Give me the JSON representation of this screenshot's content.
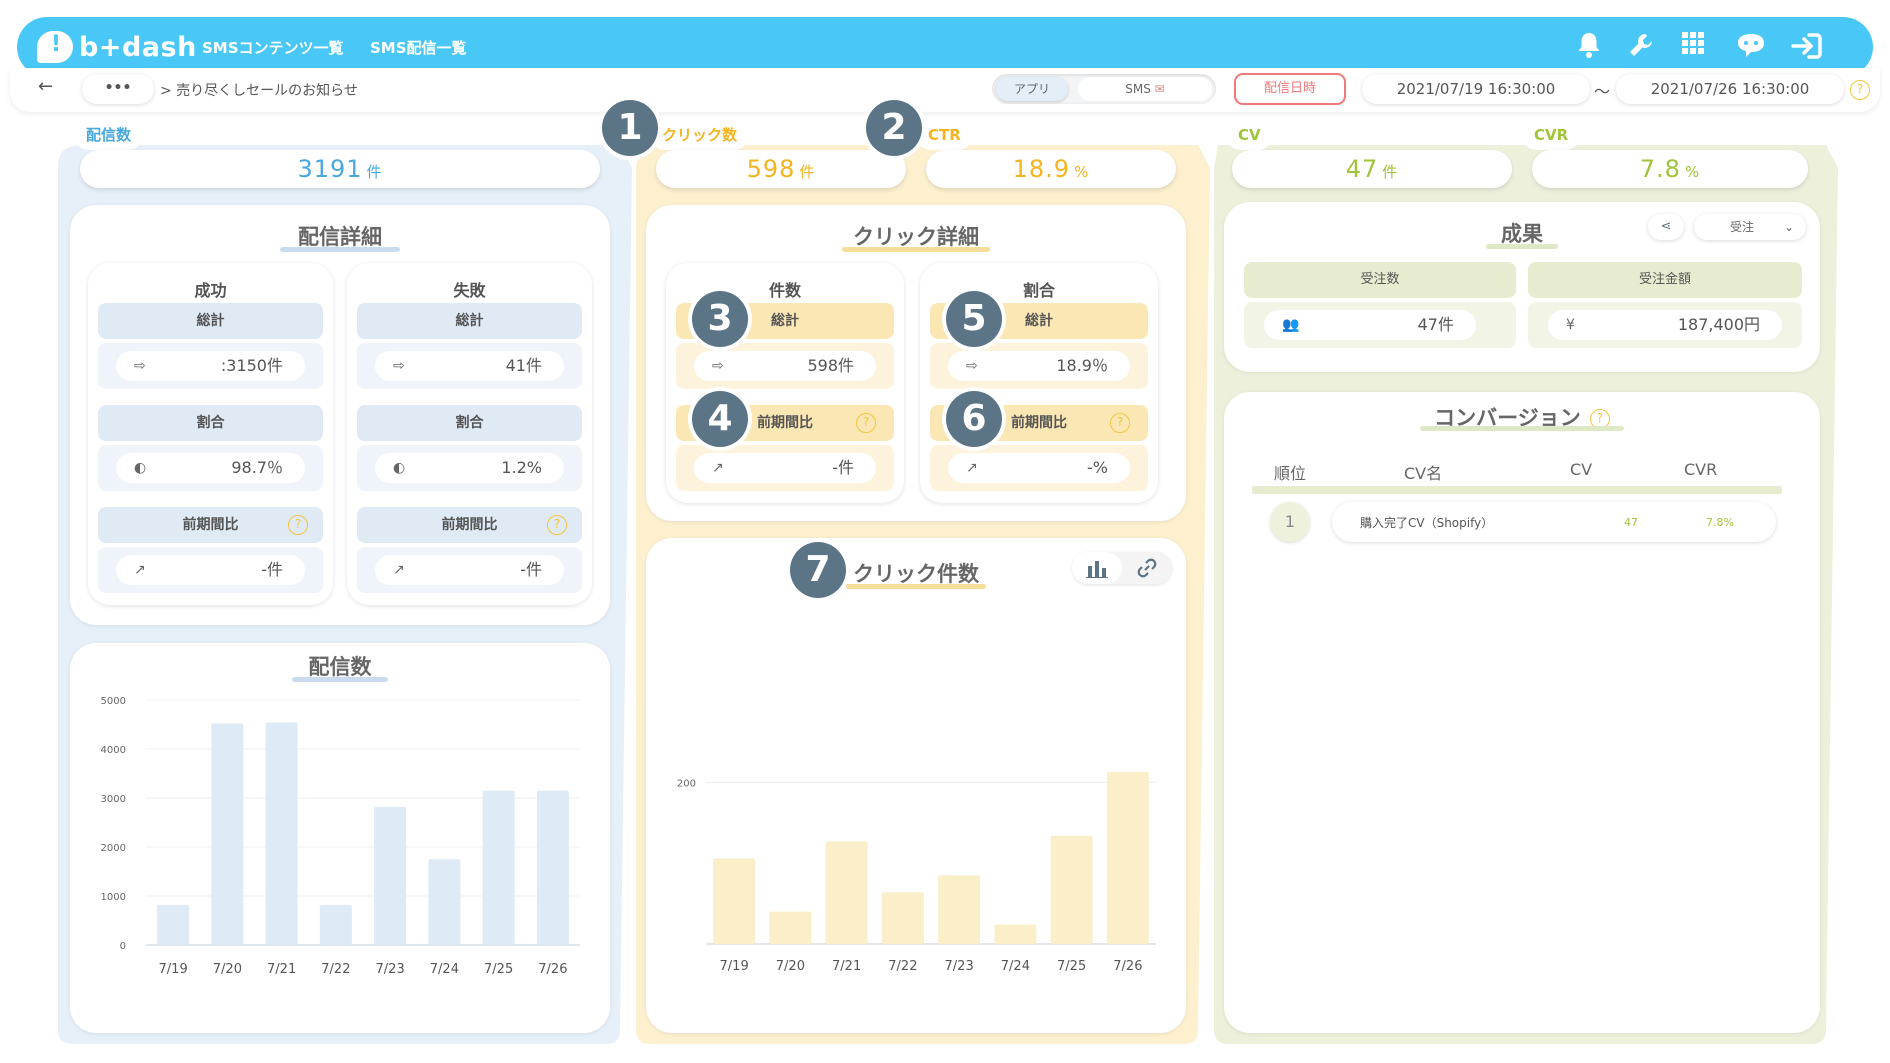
{
  "header": {
    "logo_text": "b+dash",
    "nav": [
      "SMSコンテンツ一覧",
      "SMS配信一覧"
    ],
    "icons": [
      "bell-icon",
      "wrench-icon",
      "grid-icon",
      "support-icon",
      "logout-icon"
    ]
  },
  "breadcrumb": {
    "back": "←",
    "more": "•••",
    "path": "> 売り尽くしセールのお知らせ",
    "toggle": {
      "app": "アプリ",
      "sms": "SMS"
    },
    "date_button": "配信日時",
    "date_from": "2021/07/19 16:30:00",
    "date_sep": "〜",
    "date_to": "2021/07/26 16:30:00",
    "help": "?"
  },
  "colors": {
    "blue": "#4aa8df",
    "yellow": "#f5b41e",
    "green": "#a0c43a"
  },
  "delivery": {
    "tag": "配信数",
    "value": "3191",
    "unit": "件",
    "detail": {
      "title": "配信詳細",
      "success": {
        "label": "成功",
        "total_label": "総計",
        "total_value": ":3150件",
        "ratio_label": "割合",
        "ratio_value": "98.7％",
        "prev_label": "前期間比",
        "prev_value": "-件"
      },
      "fail": {
        "label": "失敗",
        "total_label": "総計",
        "total_value": "41件",
        "ratio_label": "割合",
        "ratio_value": "1.2%",
        "prev_label": "前期間比",
        "prev_value": "-件"
      }
    },
    "chart_title": "配信数"
  },
  "click": {
    "tag": "クリック数",
    "value": "598",
    "unit": "件",
    "ctr_tag": "CTR",
    "ctr_value": "18.9",
    "ctr_unit": "%",
    "detail": {
      "title": "クリック詳細",
      "count": {
        "label": "件数",
        "total_label": "総計",
        "total_value": "598件",
        "prev_label": "前期間比",
        "prev_value": "-件"
      },
      "ratio": {
        "label": "割合",
        "total_label": "総計",
        "total_value": "18.9％",
        "prev_label": "前期間比",
        "prev_value": "-%"
      }
    },
    "chart_title": "クリック件数"
  },
  "cv": {
    "tag": "CV",
    "value": "47",
    "unit": "件",
    "cvr_tag": "CVR",
    "cvr_value": "7.8",
    "cvr_unit": "%",
    "results": {
      "title": "成果",
      "select": "受注",
      "orders_label": "受注数",
      "orders_value": "47件",
      "amount_label": "受注金額",
      "amount_value": "187,400円"
    },
    "conversion": {
      "title": "コンバージョン",
      "headers": [
        "順位",
        "CV名",
        "CV",
        "CVR"
      ],
      "rows": [
        {
          "rank": "1",
          "name": "購入完了CV（Shopify）",
          "cv": "47",
          "cvr": "7.8%"
        }
      ]
    }
  },
  "annotations": [
    "1",
    "2",
    "3",
    "4",
    "5",
    "6",
    "7"
  ],
  "chart_data": [
    {
      "type": "bar",
      "title": "配信数",
      "categories": [
        "7/19",
        "7/20",
        "7/21",
        "7/22",
        "7/23",
        "7/24",
        "7/25",
        "7/26"
      ],
      "values": [
        820,
        4520,
        4540,
        820,
        2820,
        1750,
        3150,
        3150
      ],
      "ylim": [
        0,
        5000
      ],
      "yticks": [
        0,
        1000,
        2000,
        3000,
        4000,
        5000
      ],
      "color": "#deeaf6"
    },
    {
      "type": "bar",
      "title": "クリック件数",
      "categories": [
        "7/19",
        "7/20",
        "7/21",
        "7/22",
        "7/23",
        "7/24",
        "7/25",
        "7/26"
      ],
      "values": [
        106,
        40,
        127,
        64,
        85,
        24,
        134,
        213
      ],
      "ylim": [
        0,
        250
      ],
      "yticks": [
        200
      ],
      "color": "#fbefc9"
    }
  ]
}
